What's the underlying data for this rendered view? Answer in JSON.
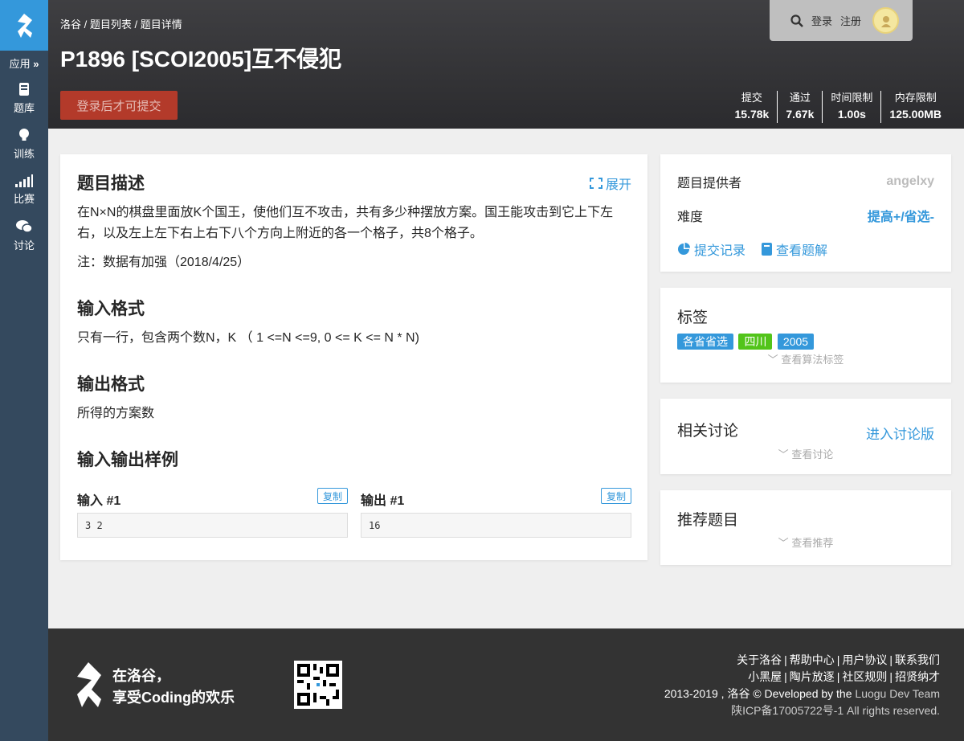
{
  "sidebar": {
    "apps_label": "应用",
    "items": [
      {
        "label": "题库",
        "icon": "book-icon"
      },
      {
        "label": "训练",
        "icon": "lightbulb-icon"
      },
      {
        "label": "比赛",
        "icon": "signal-bars-icon"
      },
      {
        "label": "讨论",
        "icon": "chat-bubbles-icon"
      }
    ]
  },
  "header": {
    "breadcrumb": [
      "洛谷",
      "题目列表",
      "题目详情"
    ],
    "breadcrumb_sep": "/",
    "title": "P1896 [SCOI2005]互不侵犯",
    "submit_label": "登录后才可提交",
    "login": "登录",
    "register": "注册",
    "stats": [
      {
        "key": "提交",
        "value": "15.78k"
      },
      {
        "key": "通过",
        "value": "7.67k"
      },
      {
        "key": "时间限制",
        "value": "1.00s"
      },
      {
        "key": "内存限制",
        "value": "125.00MB"
      }
    ]
  },
  "problem": {
    "desc_title": "题目描述",
    "expand_label": "展开",
    "desc_line1": "在N×N的棋盘里面放K个国王，使他们互不攻击，共有多少种摆放方案。国王能攻击到它上下左",
    "desc_line2": "右，以及左上左下右上右下八个方向上附近的各一个格子，共8个格子。",
    "note": "注：数据有加强（2018/4/25）",
    "input_title": "输入格式",
    "input_text": "只有一行，包含两个数N，K （ 1 <=N <=9, 0 <= K <= N * N)",
    "output_title": "输出格式",
    "output_text": "所得的方案数",
    "sample_title": "输入输出样例",
    "sample_in_label": "输入 #1",
    "sample_out_label": "输出 #1",
    "copy_label": "复制",
    "sample_in": "3 2",
    "sample_out": "16"
  },
  "info": {
    "provider_label": "题目提供者",
    "provider": "angelxy",
    "difficulty_label": "难度",
    "difficulty": "提高+/省选-",
    "records": "提交记录",
    "solutions": "查看题解"
  },
  "tags": {
    "title": "标签",
    "items": [
      {
        "text": "各省省选",
        "color": "#3498db"
      },
      {
        "text": "四川",
        "color": "#52c41a"
      },
      {
        "text": "2005",
        "color": "#3498db"
      }
    ],
    "more": "查看算法标签"
  },
  "discuss": {
    "title": "相关讨论",
    "enter": "进入讨论版",
    "more": "查看讨论"
  },
  "recommend": {
    "title": "推荐题目",
    "more": "查看推荐"
  },
  "footer": {
    "slogan1": "在洛谷，",
    "slogan2": "享受Coding的欢乐",
    "links1": [
      "关于洛谷",
      "帮助中心",
      "用户协议",
      "联系我们"
    ],
    "links2": [
      "小黑屋",
      "陶片放逐",
      "社区规则",
      "招贤纳才"
    ],
    "copyright_a": "2013-2019 , 洛谷 © Developed by the ",
    "copyright_b": "Luogu Dev Team",
    "icp": "陕ICP备17005722号-1 All rights reserved."
  },
  "colors": {
    "accent": "#3498db",
    "sidebar": "#34495e",
    "submit": "#b33a2a",
    "green_tag": "#52c41a"
  }
}
